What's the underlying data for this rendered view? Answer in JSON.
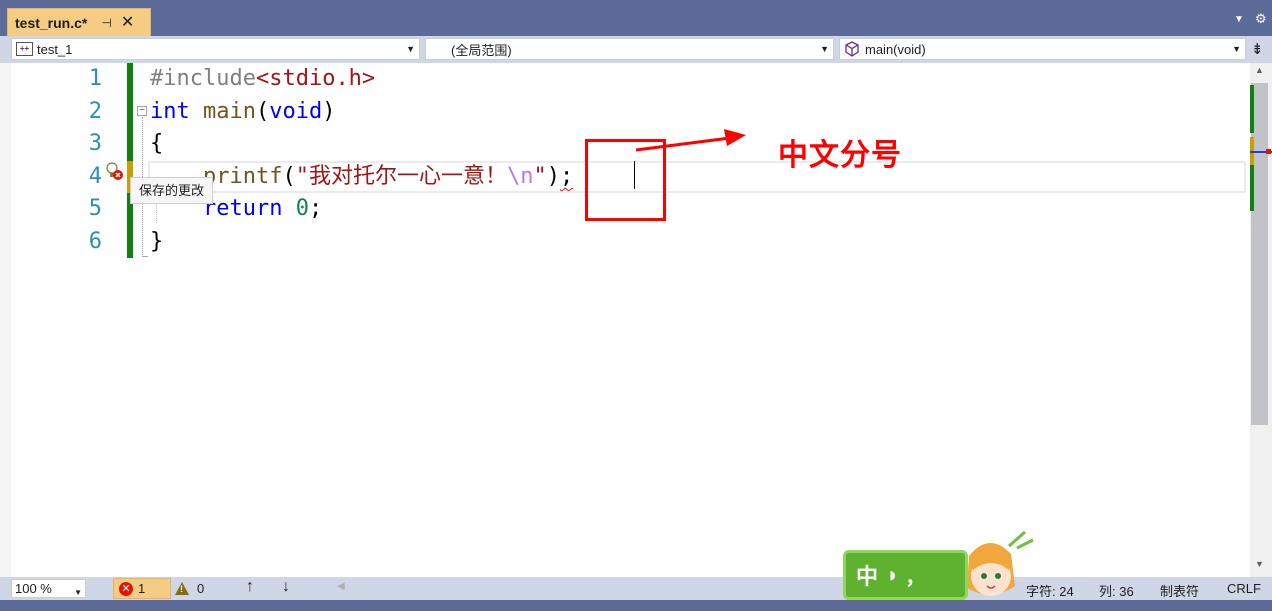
{
  "tab": {
    "title": "test_run.c*",
    "pin_glyph": "⊣",
    "close_glyph": "✕"
  },
  "navbar": {
    "project": "test_1",
    "scope": "(全局范围)",
    "function": "main(void)"
  },
  "editor": {
    "line_numbers": [
      "1",
      "2",
      "3",
      "4",
      "5",
      "6"
    ],
    "lines": {
      "l1_pre": "#include",
      "l1_inc": "<stdio.h>",
      "l2_kw1": "int",
      "l2_fn": "main",
      "l2_p1": "(",
      "l2_kw2": "void",
      "l2_p2": ")",
      "l3": "{",
      "l4_indent": "    ",
      "l4_fn": "printf",
      "l4_p1": "(",
      "l4_str": "\"我对托尔一心一意！",
      "l4_esc": "\\n",
      "l4_strend": "\"",
      "l4_p2": ")",
      "l4_semi": ";",
      "l5_indent": "    ",
      "l5_kw": "return",
      "l5_sp": " ",
      "l5_num": "0",
      "l5_semi": ";",
      "l6": "}"
    },
    "tooltip": "保存的更改",
    "annotation_label": "中文分号"
  },
  "statusbar": {
    "zoom": "100 %",
    "errors": "1",
    "warnings": "0",
    "char": "字符: 24",
    "col": "列: 36",
    "tabs": "制表符",
    "eol": "CRLF"
  },
  "ime": {
    "mode": "中",
    "punct": "，"
  },
  "colors": {
    "chrome": "#5d6b99",
    "tab_active": "#f5cc84",
    "change_saved": "#108010",
    "change_unsaved": "#c8a000",
    "annotation": "#ff0000"
  }
}
